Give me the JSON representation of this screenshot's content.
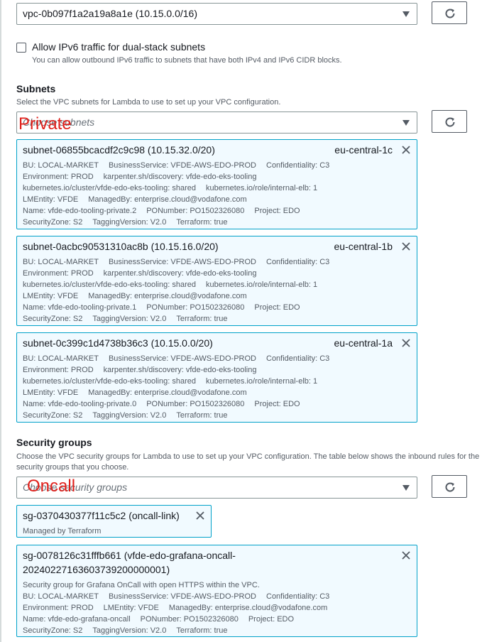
{
  "vpc": {
    "selected": "vpc-0b097f1a2a19a8a1e (10.15.0.0/16)"
  },
  "ipv6": {
    "label": "Allow IPv6 traffic for dual-stack subnets",
    "description": "You can allow outbound IPv6 traffic to subnets that have both IPv4 and IPv6 CIDR blocks."
  },
  "subnets": {
    "title": "Subnets",
    "description": "Select the VPC subnets for Lambda to use to set up your VPC configuration.",
    "placeholder": "Choose subnets",
    "annotation": "Private",
    "items": [
      {
        "title": "subnet-06855bcacdf2c9c98 (10.15.32.0/20)",
        "az": "eu-central-1c",
        "lines": [
          [
            "BU: LOCAL-MARKET",
            "BusinessService: VFDE-AWS-EDO-PROD",
            "Confidentiality: C3"
          ],
          [
            "Environment: PROD",
            "karpenter.sh/discovery: vfde-edo-eks-tooling"
          ],
          [
            "kubernetes.io/cluster/vfde-edo-eks-tooling: shared",
            "kubernetes.io/role/internal-elb: 1"
          ],
          [
            "LMEntity: VFDE",
            "ManagedBy: enterprise.cloud@vodafone.com"
          ],
          [
            "Name: vfde-edo-tooling-private.2",
            "PONumber: PO1502326080",
            "Project: EDO"
          ],
          [
            "SecurityZone: S2",
            "TaggingVersion: V2.0",
            "Terraform: true"
          ]
        ]
      },
      {
        "title": "subnet-0acbc90531310ac8b (10.15.16.0/20)",
        "az": "eu-central-1b",
        "lines": [
          [
            "BU: LOCAL-MARKET",
            "BusinessService: VFDE-AWS-EDO-PROD",
            "Confidentiality: C3"
          ],
          [
            "Environment: PROD",
            "karpenter.sh/discovery: vfde-edo-eks-tooling"
          ],
          [
            "kubernetes.io/cluster/vfde-edo-eks-tooling: shared",
            "kubernetes.io/role/internal-elb: 1"
          ],
          [
            "LMEntity: VFDE",
            "ManagedBy: enterprise.cloud@vodafone.com"
          ],
          [
            "Name: vfde-edo-tooling-private.1",
            "PONumber: PO1502326080",
            "Project: EDO"
          ],
          [
            "SecurityZone: S2",
            "TaggingVersion: V2.0",
            "Terraform: true"
          ]
        ]
      },
      {
        "title": "subnet-0c399c1d4738b36c3 (10.15.0.0/20)",
        "az": "eu-central-1a",
        "lines": [
          [
            "BU: LOCAL-MARKET",
            "BusinessService: VFDE-AWS-EDO-PROD",
            "Confidentiality: C3"
          ],
          [
            "Environment: PROD",
            "karpenter.sh/discovery: vfde-edo-eks-tooling"
          ],
          [
            "kubernetes.io/cluster/vfde-edo-eks-tooling: shared",
            "kubernetes.io/role/internal-elb: 1"
          ],
          [
            "LMEntity: VFDE",
            "ManagedBy: enterprise.cloud@vodafone.com"
          ],
          [
            "Name: vfde-edo-tooling-private.0",
            "PONumber: PO1502326080",
            "Project: EDO"
          ],
          [
            "SecurityZone: S2",
            "TaggingVersion: V2.0",
            "Terraform: true"
          ]
        ]
      }
    ]
  },
  "security_groups": {
    "title": "Security groups",
    "description": "Choose the VPC security groups for Lambda to use to set up your VPC configuration. The table below shows the inbound rules for the security groups that you choose.",
    "placeholder": "Choose security groups",
    "annotation": "Oncall",
    "items": [
      {
        "title": "sg-0370430377f11c5c2 (oncall-link)",
        "lines": [
          [
            "Managed by Terraform"
          ]
        ]
      },
      {
        "title": "sg-0078126c31fffb661 (vfde-edo-grafana-oncall-",
        "title2": "20240227163603739200000001)",
        "lines": [
          [
            "Security group for Grafana OnCall with open HTTPS within the VPC."
          ],
          [
            "BU: LOCAL-MARKET",
            "BusinessService: VFDE-AWS-EDO-PROD",
            "Confidentiality: C3"
          ],
          [
            "Environment: PROD",
            "LMEntity: VFDE",
            "ManagedBy: enterprise.cloud@vodafone.com"
          ],
          [
            "Name: vfde-edo-grafana-oncall",
            "PONumber: PO1502326080",
            "Project: EDO"
          ],
          [
            "SecurityZone: S2",
            "TaggingVersion: V2.0",
            "Terraform: true"
          ]
        ]
      }
    ]
  },
  "icons": {
    "refresh": "refresh-icon",
    "close": "close-icon",
    "caret": "caret-down-icon"
  },
  "colors": {
    "token_border": "#00a1c9",
    "token_bg": "#f1faff",
    "annotation": "#e0201b"
  }
}
